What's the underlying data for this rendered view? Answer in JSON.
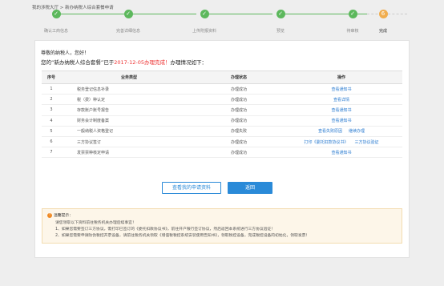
{
  "breadcrumb": "我的涉税大厅 > 新办纳税人综合套餐申请",
  "steps": [
    {
      "index": "✓",
      "label": "确认工商信息",
      "state": "done"
    },
    {
      "index": "✓",
      "label": "完善详细信息",
      "state": "done"
    },
    {
      "index": "✓",
      "label": "上传附报资料",
      "state": "done"
    },
    {
      "index": "✓",
      "label": "预览",
      "state": "done"
    },
    {
      "index": "✓",
      "label": "待审核",
      "state": "done"
    },
    {
      "index": "6",
      "label": "完成",
      "state": "current"
    }
  ],
  "greeting": "尊敬的纳税人，您好！",
  "notice": {
    "prefix": "您的“新办纳税人综合套餐”已于",
    "date": "2017-12-05",
    "status": "办理完成！",
    "suffix": "办理情况如下："
  },
  "table": {
    "headers": [
      "序号",
      "业务类型",
      "办理状态",
      "操作"
    ],
    "rows": [
      {
        "no": "1",
        "type": "税务登记信息补录",
        "status": "办理成功",
        "status_kind": "ok",
        "ops": [
          "查看通知书"
        ]
      },
      {
        "no": "2",
        "type": "税（费）种认定",
        "status": "办理成功",
        "status_kind": "ok",
        "ops": [
          "查看详情"
        ]
      },
      {
        "no": "3",
        "type": "存款账户账号报告",
        "status": "办理成功",
        "status_kind": "done",
        "ops": [
          "查看通知书"
        ]
      },
      {
        "no": "4",
        "type": "财务会计制度备案",
        "status": "办理成功",
        "status_kind": "done",
        "ops": [
          "查看通知书"
        ]
      },
      {
        "no": "5",
        "type": "一般纳税人资格登记",
        "status": "办理失败",
        "status_kind": "fail",
        "ops": [
          "查看失败原因",
          "继续办理"
        ]
      },
      {
        "no": "6",
        "type": "三方协议签订",
        "status": "办理成功",
        "status_kind": "done",
        "ops": [
          "打印《委托扣款协议书》",
          "三方协议验证"
        ]
      },
      {
        "no": "7",
        "type": "发票票种核定申请",
        "status": "办理成功",
        "status_kind": "done",
        "ops": [
          "查看通知书"
        ]
      }
    ]
  },
  "buttons": {
    "view_application": "查看我的申请资料",
    "return": "返回"
  },
  "tips": {
    "title": "温馨提示：",
    "lines": [
      "请您领取以下资料前往税务机关办理后续事宜！",
      "1、如果您需要签订三方协议，需打印已签订的《委托扣款协议书》，前往开户银行签订协议，然后返回本系统进行三方协议验证！",
      "2、如果您需要申请防伪税控开票设备，请前往税务机关领取《增值税税控系统安装使用告知书》，领取税控设备，完成税控设备的初始化，领取发票！"
    ]
  },
  "colors": {
    "accent": "#2a8ad8",
    "success": "#5cb85c",
    "current": "#f0ad4e",
    "error": "#e33333"
  }
}
